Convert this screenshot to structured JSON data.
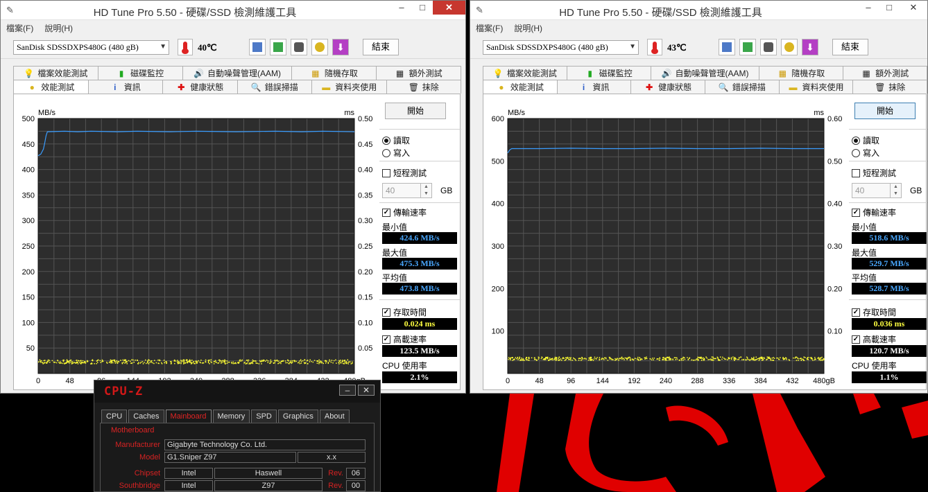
{
  "windows": [
    {
      "title": "HD Tune Pro 5.50 - 硬碟/SSD 檢測維護工具",
      "menu": [
        "檔案(F)",
        "說明(H)"
      ],
      "drive": "SanDisk SDSSDXPS480G (480 gB)",
      "temperature": "40℃",
      "exit_label": "結束",
      "tabs_top": [
        "檔案效能測試",
        "磁碟監控",
        "自動噪聲管理(AAM)",
        "隨機存取",
        "額外測試"
      ],
      "tabs_bottom": [
        "效能測試",
        "資訊",
        "健康狀態",
        "錯誤掃描",
        "資料夾使用",
        "抹除"
      ],
      "start_label": "開始",
      "read_label": "讀取",
      "write_label": "寫入",
      "short_test_label": "短程測試",
      "size_value": "40",
      "size_unit": "GB",
      "transfer_label": "傳輸速率",
      "min_label": "最小值",
      "min_value": "424.6 MB/s",
      "max_label": "最大值",
      "max_value": "475.3 MB/s",
      "avg_label": "平均值",
      "avg_value": "473.8 MB/s",
      "access_label": "存取時間",
      "access_value": "0.024 ms",
      "burst_label": "高載速率",
      "burst_value": "123.5 MB/s",
      "cpu_label": "CPU 使用率",
      "cpu_value": "2.1%"
    },
    {
      "title": "HD Tune Pro 5.50 - 硬碟/SSD 檢測維護工具",
      "menu": [
        "檔案(F)",
        "說明(H)"
      ],
      "drive": "SanDisk SDSSDXPS480G (480 gB)",
      "temperature": "43℃",
      "exit_label": "結束",
      "tabs_top": [
        "檔案效能測試",
        "磁碟監控",
        "自動噪聲管理(AAM)",
        "隨機存取",
        "額外測試"
      ],
      "tabs_bottom": [
        "效能測試",
        "資訊",
        "健康狀態",
        "錯誤掃描",
        "資料夾使用",
        "抹除"
      ],
      "start_label": "開始",
      "read_label": "讀取",
      "write_label": "寫入",
      "short_test_label": "短程測試",
      "size_value": "40",
      "size_unit": "GB",
      "transfer_label": "傳輸速率",
      "min_label": "最小值",
      "min_value": "518.6 MB/s",
      "max_label": "最大值",
      "max_value": "529.7 MB/s",
      "avg_label": "平均值",
      "avg_value": "528.7 MB/s",
      "access_label": "存取時間",
      "access_value": "0.036 ms",
      "burst_label": "高載速率",
      "burst_value": "120.7 MB/s",
      "cpu_label": "CPU 使用率",
      "cpu_value": "1.1%"
    }
  ],
  "colors": {
    "plot_bg": "#2d2d2d",
    "grid": "#555555",
    "transfer_line": "#3a9dff",
    "access_dots": "#ffff33",
    "cpuz_red": "#d21818"
  },
  "chart_data": [
    {
      "type": "line",
      "ylabel_left": "MB/s",
      "ylabel_right": "ms",
      "x_ticks": [
        "0",
        "48",
        "96",
        "144",
        "192",
        "240",
        "288",
        "336",
        "384",
        "432",
        "480gB"
      ],
      "xlim": [
        0,
        480
      ],
      "ylim_left": [
        0,
        500
      ],
      "ylim_right": [
        0,
        0.5
      ],
      "left_ticks": [
        "500",
        "450",
        "400",
        "350",
        "300",
        "250",
        "200",
        "150",
        "100",
        "50"
      ],
      "right_ticks": [
        "0.50",
        "0.45",
        "0.40",
        "0.35",
        "0.30",
        "0.25",
        "0.20",
        "0.15",
        "0.10",
        "0.05"
      ],
      "grid": true,
      "series": [
        {
          "values": [
            [
              0,
              427
            ],
            [
              4,
              430
            ],
            [
              8,
              440
            ],
            [
              10,
              452
            ],
            [
              12,
              466
            ],
            [
              14,
              474
            ],
            [
              40,
              475
            ],
            [
              60,
              474
            ],
            [
              80,
              475
            ],
            [
              120,
              474
            ],
            [
              150,
              475
            ],
            [
              200,
              474
            ],
            [
              240,
              475
            ],
            [
              300,
              474
            ],
            [
              360,
              475
            ],
            [
              400,
              474
            ],
            [
              432,
              475
            ],
            [
              480,
              474
            ]
          ]
        }
      ],
      "access_scatter": {
        "center_ms": 0.024,
        "spread_ms": 0.004
      }
    },
    {
      "type": "line",
      "ylabel_left": "MB/s",
      "ylabel_right": "ms",
      "x_ticks": [
        "0",
        "48",
        "96",
        "144",
        "192",
        "240",
        "288",
        "336",
        "384",
        "432",
        "480gB"
      ],
      "xlim": [
        0,
        480
      ],
      "ylim_left": [
        0,
        600
      ],
      "ylim_right": [
        0,
        0.6
      ],
      "left_ticks": [
        "600",
        "500",
        "400",
        "300",
        "200",
        "100"
      ],
      "right_ticks": [
        "0.60",
        "0.50",
        "0.40",
        "0.30",
        "0.20",
        "0.10"
      ],
      "grid": true,
      "series": [
        {
          "values": [
            [
              0,
              519
            ],
            [
              3,
              526
            ],
            [
              6,
              529
            ],
            [
              48,
              529
            ],
            [
              96,
              530
            ],
            [
              144,
              529
            ],
            [
              192,
              529
            ],
            [
              240,
              530
            ],
            [
              288,
              529
            ],
            [
              336,
              529
            ],
            [
              384,
              530
            ],
            [
              432,
              529
            ],
            [
              480,
              529
            ]
          ]
        }
      ],
      "access_scatter": {
        "center_ms": 0.036,
        "spread_ms": 0.004
      }
    }
  ],
  "cpuz": {
    "logo": "CPU-Z",
    "tabs": [
      "CPU",
      "Caches",
      "Mainboard",
      "Memory",
      "SPD",
      "Graphics",
      "About"
    ],
    "active_tab": "Mainboard",
    "group_label": "Motherboard",
    "manufacturer_label": "Manufacturer",
    "manufacturer": "Gigabyte Technology Co. Ltd.",
    "model_label": "Model",
    "model": "G1.Sniper Z97",
    "model_rev": "x.x",
    "chipset_label": "Chipset",
    "chipset_vendor": "Intel",
    "chipset_name": "Haswell",
    "rev_label": "Rev.",
    "chipset_rev": "06",
    "southbridge_label": "Southbridge",
    "southbridge_vendor": "Intel",
    "southbridge_name": "Z97",
    "southbridge_rev": "00"
  }
}
